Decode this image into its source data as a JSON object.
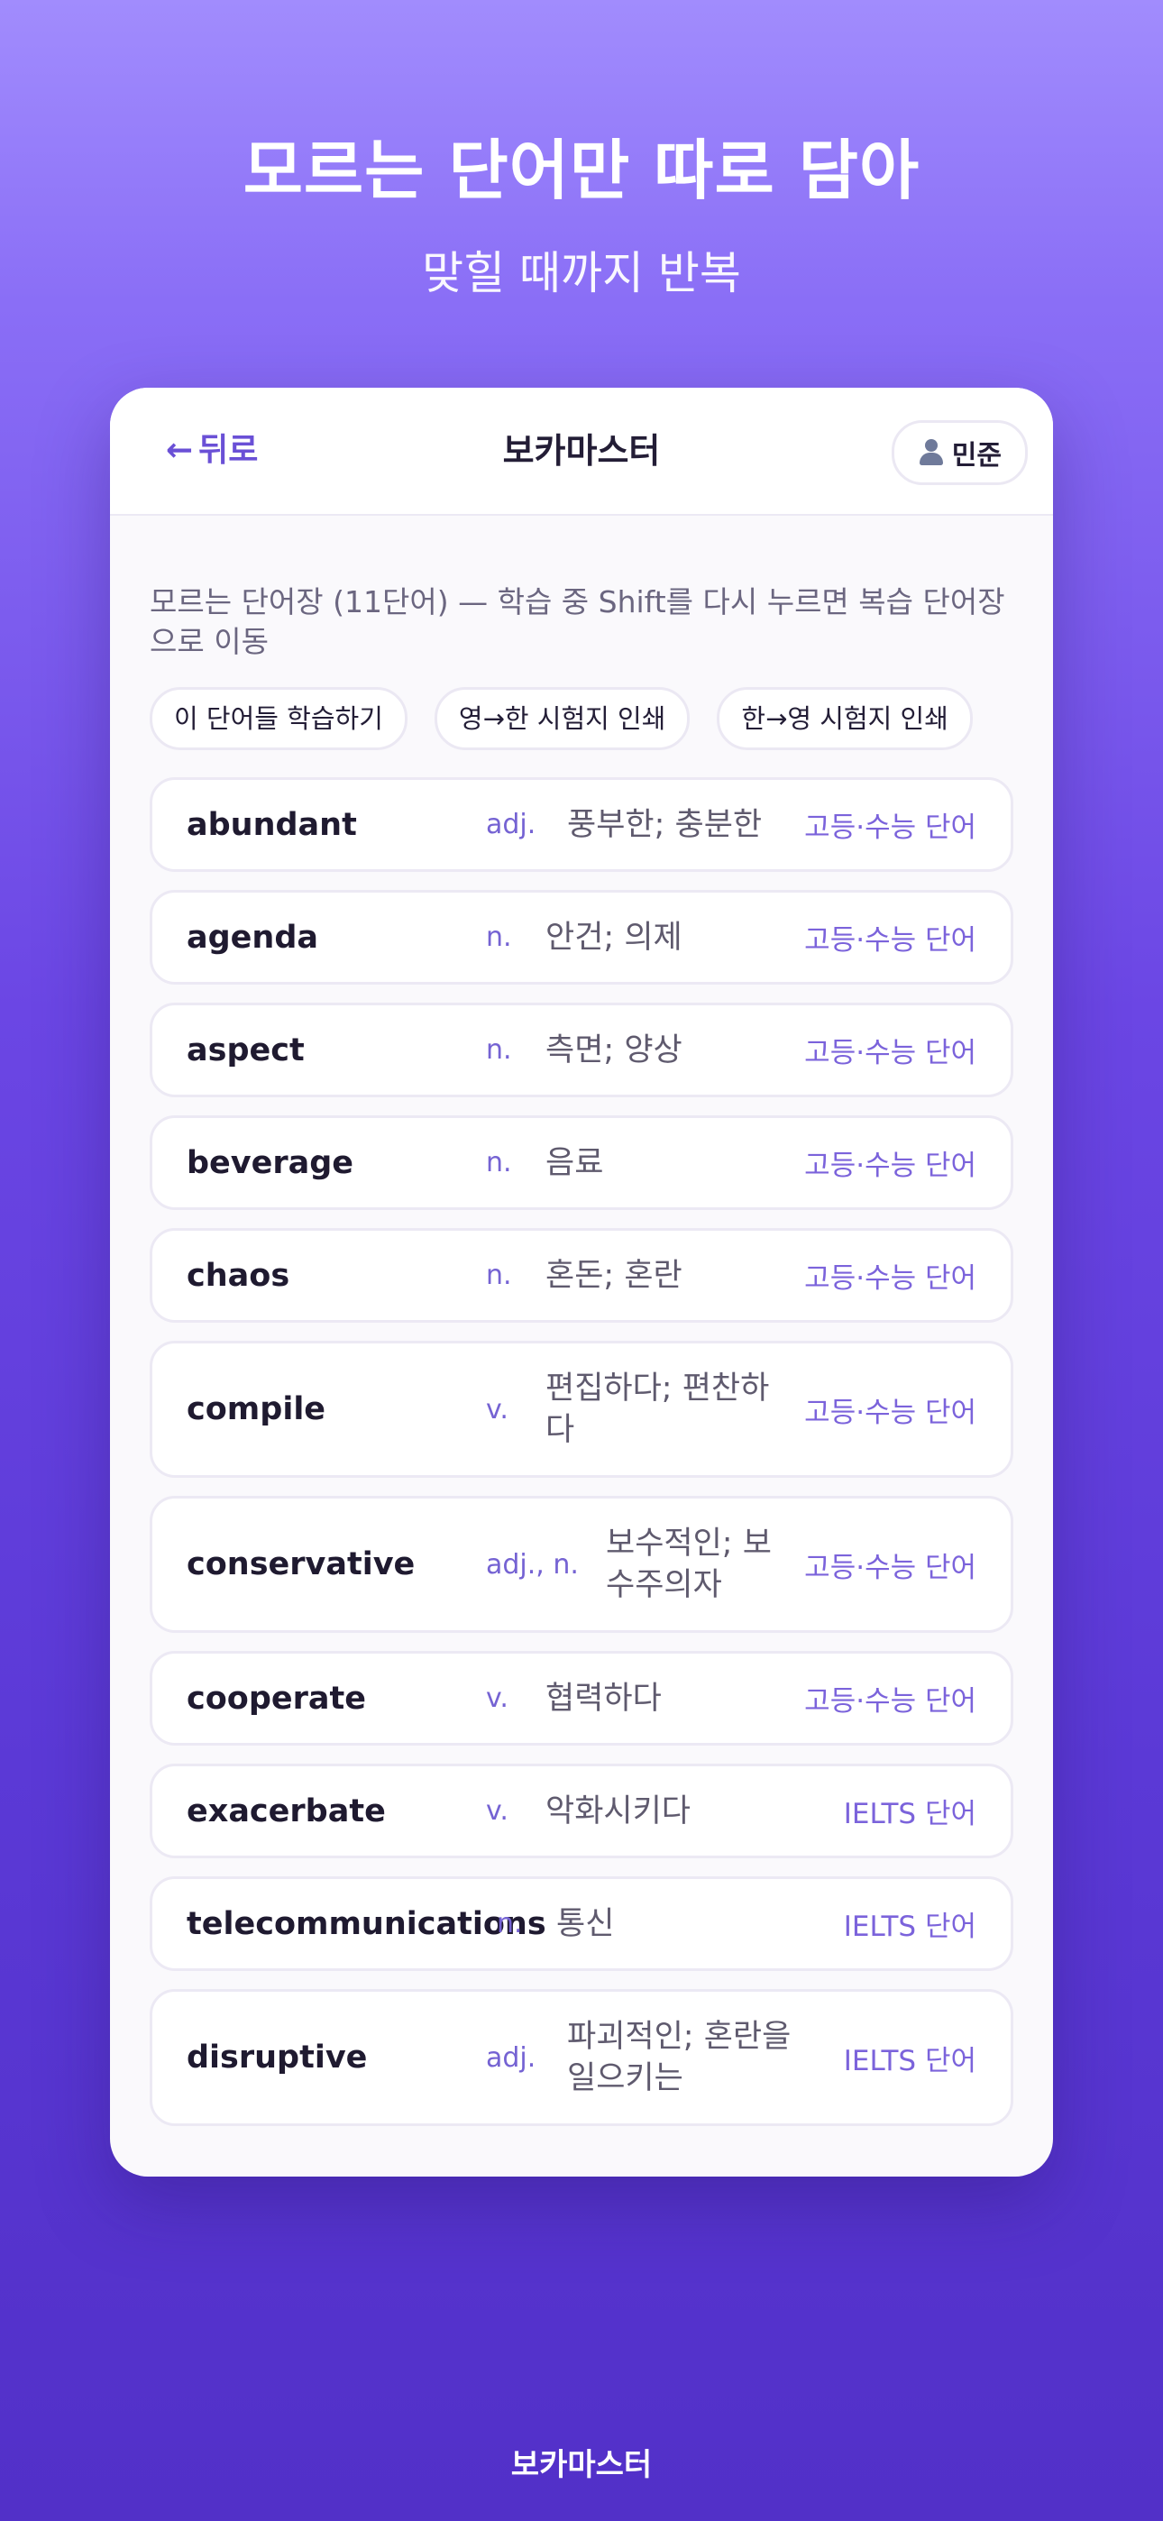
{
  "hero": {
    "title": "모르는 단어만 따로 담아",
    "subtitle": "맞힐 때까지 반복"
  },
  "topbar": {
    "back_label": "뒤로",
    "app_title": "보카마스터",
    "user_name": "민준",
    "user_icon": "user-icon",
    "back_icon": "arrow-left-icon"
  },
  "description": "모르는 단어장 (11단어) — 학습 중 Shift를 다시 누르면 복습 단어장으로 이동",
  "actions": {
    "study": "이 단어들 학습하기",
    "print_en_ko": "영→한 시험지 인쇄",
    "print_ko_en": "한→영 시험지 인쇄"
  },
  "words": [
    {
      "word": "abundant",
      "pos": "adj.",
      "meaning": "풍부한; 충분한",
      "category": "고등·수능 단어"
    },
    {
      "word": "agenda",
      "pos": "n.",
      "meaning": "안건; 의제",
      "category": "고등·수능 단어"
    },
    {
      "word": "aspect",
      "pos": "n.",
      "meaning": "측면; 양상",
      "category": "고등·수능 단어"
    },
    {
      "word": "beverage",
      "pos": "n.",
      "meaning": "음료",
      "category": "고등·수능 단어"
    },
    {
      "word": "chaos",
      "pos": "n.",
      "meaning": "혼돈; 혼란",
      "category": "고등·수능 단어"
    },
    {
      "word": "compile",
      "pos": "v.",
      "meaning": "편집하다; 편찬하다",
      "category": "고등·수능 단어"
    },
    {
      "word": "conservative",
      "pos": "adj., n.",
      "meaning": "보수적인; 보수주의자",
      "category": "고등·수능 단어"
    },
    {
      "word": "cooperate",
      "pos": "v.",
      "meaning": "협력하다",
      "category": "고등·수능 단어"
    },
    {
      "word": "exacerbate",
      "pos": "v.",
      "meaning": "악화시키다",
      "category": "IELTS 단어"
    },
    {
      "word": "telecommunications",
      "pos": "n.",
      "meaning": "통신",
      "category": "IELTS 단어"
    },
    {
      "word": "disruptive",
      "pos": "adj.",
      "meaning": "파괴적인; 혼란을 일으키는",
      "category": "IELTS 단어"
    }
  ],
  "footer": "보카마스터",
  "colors": {
    "accent": "#6a50d6",
    "background_top": "#a18cfd",
    "background_bottom": "#5230c8"
  }
}
